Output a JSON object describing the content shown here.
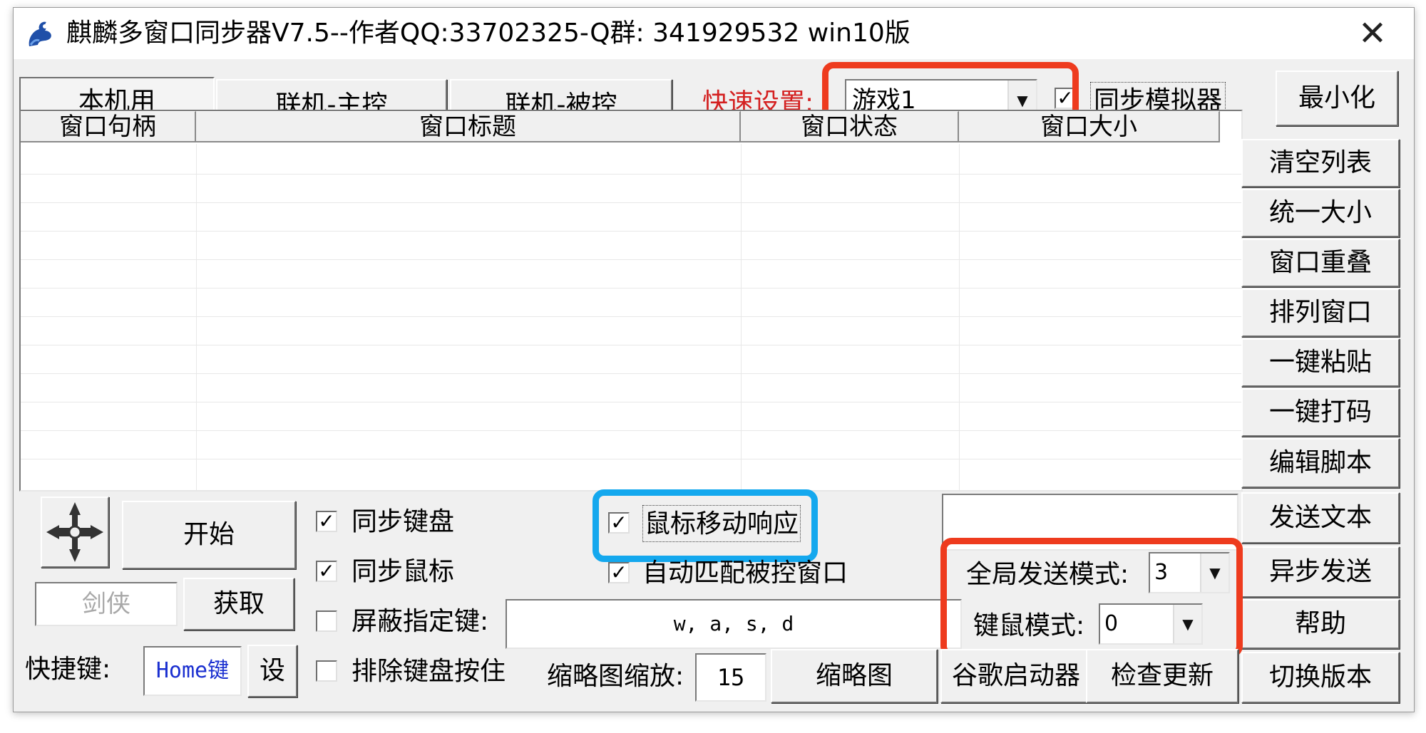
{
  "window": {
    "title": "麒麟多窗口同步器V7.5--作者QQ:33702325-Q群:  341929532  win10版",
    "close_glyph": "✕"
  },
  "toolbar": {
    "tabs": [
      "本机用",
      "联机-主控",
      "联机-被控"
    ],
    "quick_label": "快速设置:",
    "quick_select_value": "游戏1",
    "sync_emulator_label": "同步模拟器",
    "minimize_label": "最小化"
  },
  "list": {
    "columns": [
      "窗口句柄",
      "窗口标题",
      "窗口状态",
      "窗口大小"
    ],
    "rows": []
  },
  "right_buttons": [
    "清空列表",
    "统一大小",
    "窗口重叠",
    "排列窗口",
    "一键粘贴",
    "一键打码",
    "编辑脚本",
    "发送文本",
    "异步发送",
    "帮助",
    "切换版本"
  ],
  "controls": {
    "start_label": "开始",
    "target_field_value": "剑侠",
    "fetch_label": "获取",
    "hotkey_label": "快捷键:",
    "hotkey_value": "Home键",
    "hotkey_set_label": "设",
    "sync_keyboard": "同步键盘",
    "sync_mouse": "同步鼠标",
    "block_keys": "屏蔽指定键:",
    "exclude_hold": "排除键盘按住",
    "mouse_move": "鼠标移动响应",
    "auto_match": "自动匹配被控窗口",
    "blocked_keys_value": "w, a, s, d",
    "thumb_zoom_label": "缩略图缩放:",
    "thumb_zoom_value": "15",
    "thumbnail_btn": "缩略图",
    "chrome_launcher_btn": "谷歌启动器",
    "check_update_btn": "检查更新",
    "global_send_label": "全局发送模式:",
    "global_send_value": "3",
    "km_mode_label": "键鼠模式:",
    "km_mode_value": "0"
  },
  "checkbox_glyph": "✓",
  "dropdown_glyph": "▼",
  "colors": {
    "highlight_red": "#ee3b1e",
    "highlight_blue": "#14a8ee",
    "quick_label": "#d42020",
    "hotkey_text": "#1a2fd0"
  }
}
